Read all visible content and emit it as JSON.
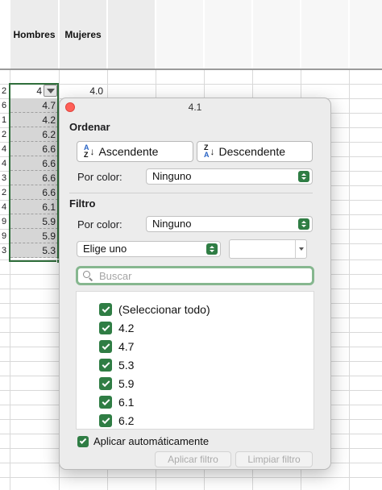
{
  "sheet": {
    "headers": {
      "hombres": "Hombres",
      "mujeres": "Mujeres"
    },
    "row_index": [
      "2",
      "6",
      "1",
      "2",
      "4",
      "4",
      "3",
      "2",
      "4",
      "9",
      "9",
      "3"
    ],
    "hombres_values": [
      "4",
      "4.7",
      "4.2",
      "6.2",
      "6.6",
      "6.6",
      "6.6",
      "6.6",
      "6.1",
      "5.9",
      "5.9",
      "5.3"
    ],
    "mujeres_first": "4.0"
  },
  "popover": {
    "title": "4.1",
    "sort": {
      "heading": "Ordenar",
      "asc_label": "Ascendente",
      "desc_label": "Descendente",
      "by_color_label": "Por color:",
      "by_color_value": "Ninguno"
    },
    "filter": {
      "heading": "Filtro",
      "by_color_label": "Por color:",
      "by_color_value": "Ninguno",
      "condition_value": "Elige uno",
      "condition_input": "",
      "search_placeholder": "Buscar",
      "items": [
        {
          "label": "(Seleccionar todo)",
          "checked": true
        },
        {
          "label": "4.2",
          "checked": true
        },
        {
          "label": "4.7",
          "checked": true
        },
        {
          "label": "5.3",
          "checked": true
        },
        {
          "label": "5.9",
          "checked": true
        },
        {
          "label": "6.1",
          "checked": true
        },
        {
          "label": "6.2",
          "checked": true
        }
      ]
    },
    "auto_apply": {
      "label": "Aplicar automáticamente",
      "checked": true
    },
    "apply_button": "Aplicar filtro",
    "clear_button": "Limpiar filtro"
  },
  "colors": {
    "accent_green": "#2f7d44",
    "selection_border": "#2f6e3b",
    "close_button": "#ff5f57"
  }
}
